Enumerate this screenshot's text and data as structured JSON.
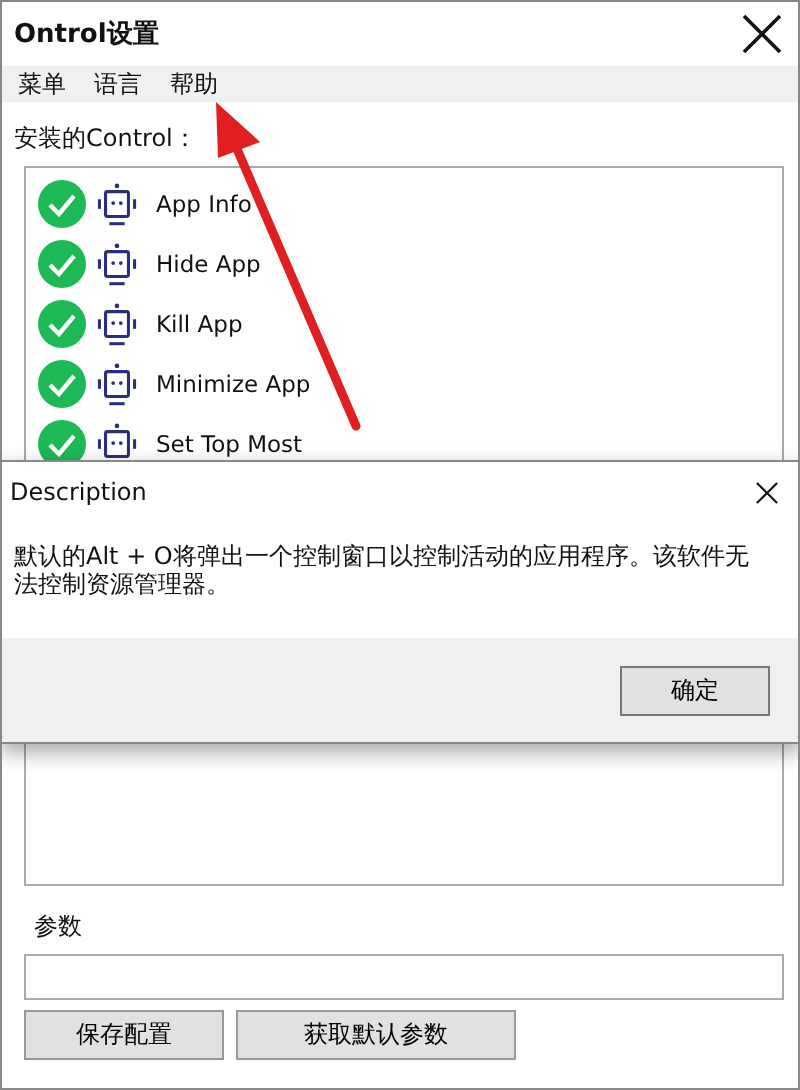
{
  "window": {
    "title": "Ontrol设置"
  },
  "menu": [
    "菜单",
    "语言",
    "帮助"
  ],
  "installed_label": "安装的Control：",
  "controls": [
    {
      "name": "App Info",
      "enabled": true
    },
    {
      "name": "Hide App",
      "enabled": true
    },
    {
      "name": "Kill App",
      "enabled": true
    },
    {
      "name": "Minimize App",
      "enabled": true
    },
    {
      "name": "Set Top Most",
      "enabled": true
    }
  ],
  "params_label": "参数",
  "buttons": [
    "保存配置",
    "获取默认参数"
  ],
  "dialog": {
    "title": "Description",
    "message": "默认的Alt + O将弹出一个控制窗口以控制活动的应用程序。该软件无法控制资源管理器。",
    "button": "确定"
  }
}
